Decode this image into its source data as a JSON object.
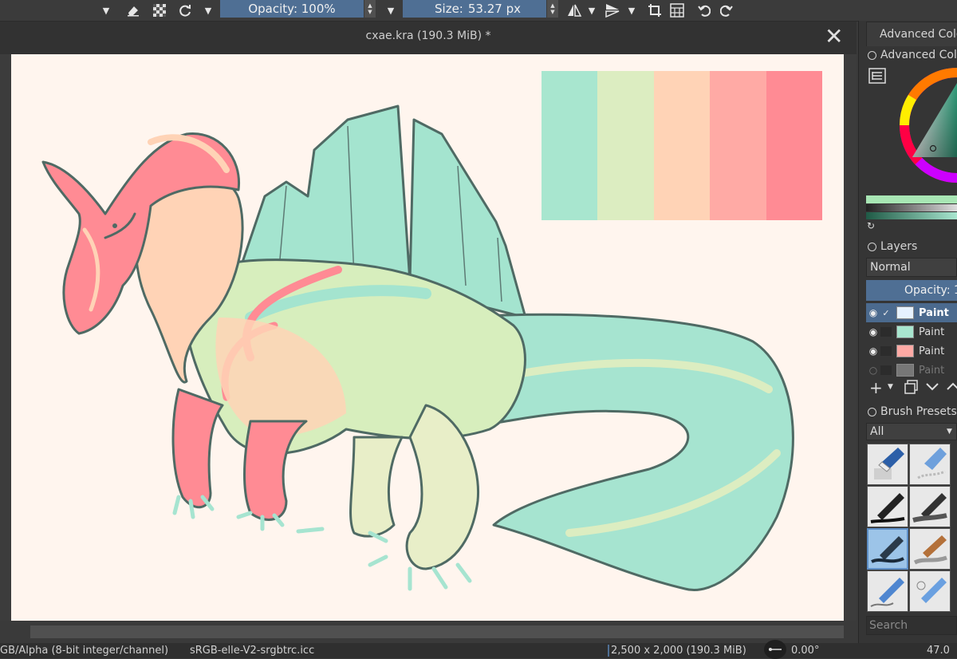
{
  "toolbar": {
    "opacity_label": "Opacity: 100%",
    "size_label": "Size:",
    "size_value": "53.27 px"
  },
  "document": {
    "title": "cxae.kra (190.3 MiB) *"
  },
  "palette_swatches": [
    "#a8e6cf",
    "#dcedc1",
    "#ffd3b6",
    "#ffaaa5",
    "#ff8b94"
  ],
  "dock": {
    "advanced_color_tab": "Advanced Colo",
    "advanced_color_header": "Advanced Colo",
    "layers_header": "Layers",
    "blend_mode": "Normal",
    "opacity_label": "Opacity:  1",
    "layers": [
      {
        "name": "Paint",
        "active": true,
        "visible": true
      },
      {
        "name": "Paint",
        "active": false,
        "visible": true
      },
      {
        "name": "Paint",
        "active": false,
        "visible": true
      },
      {
        "name": "Paint",
        "active": false,
        "visible": false
      }
    ],
    "brush_presets_header": "Brush Presets",
    "brush_filter": "All",
    "search_placeholder": "Search"
  },
  "status": {
    "color_space": "GB/Alpha (8-bit integer/channel)",
    "profile": "sRGB-elle-V2-srgbtrc.icc",
    "dimensions": "2,500 x 2,000 (190.3 MiB)",
    "rotation": "0.00°",
    "zoom": "47.0"
  }
}
